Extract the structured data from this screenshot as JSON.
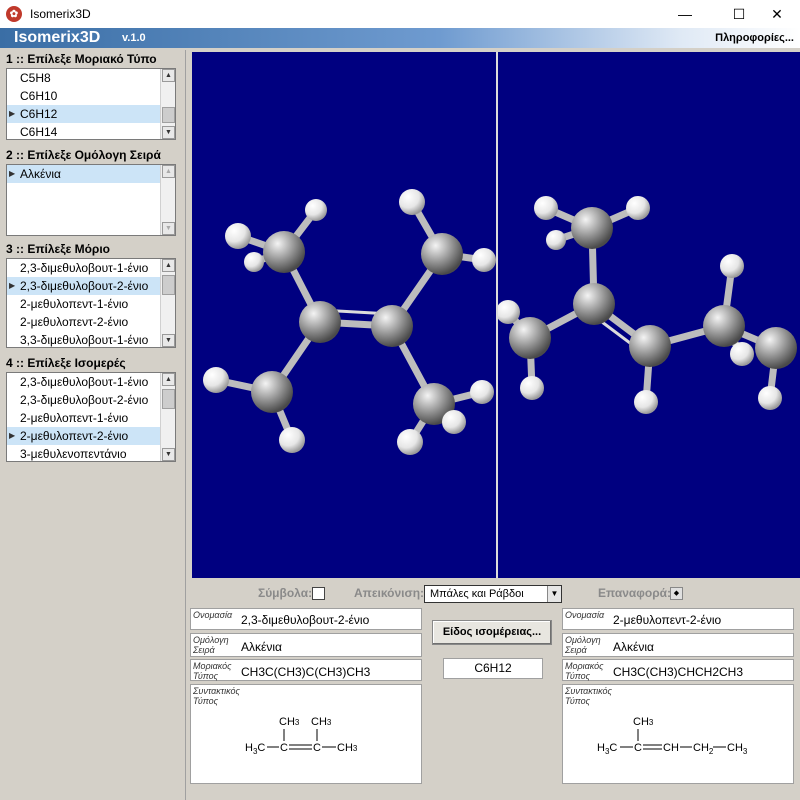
{
  "window": {
    "title": "Isomerix3D",
    "minimize": "—",
    "maximize": "☐",
    "close": "✕"
  },
  "banner": {
    "app_name": "Isomerix3D",
    "version": "v.1.0",
    "info_link": "Πληροφορίες..."
  },
  "step1": {
    "title": "1 :: Επίλεξε Μοριακό Τύπο",
    "items": [
      {
        "label": "C5H8",
        "selected": false
      },
      {
        "label": "C6H10",
        "selected": false
      },
      {
        "label": "C6H12",
        "selected": true
      },
      {
        "label": "C6H14",
        "selected": false
      }
    ]
  },
  "step2": {
    "title": "2 :: Επίλεξε Ομόλογη Σειρά",
    "items": [
      {
        "label": "Αλκένια",
        "selected": true
      }
    ]
  },
  "step3": {
    "title": "3 :: Επίλεξε Μόριο",
    "items": [
      {
        "label": "2,3-διμεθυλοβουτ-1-ένιο",
        "selected": false
      },
      {
        "label": "2,3-διμεθυλοβουτ-2-ένιο",
        "selected": true
      },
      {
        "label": "2-μεθυλοπεντ-1-ένιο",
        "selected": false
      },
      {
        "label": "2-μεθυλοπεντ-2-ένιο",
        "selected": false
      },
      {
        "label": "3,3-διμεθυλοβουτ-1-ένιο",
        "selected": false
      }
    ]
  },
  "step4": {
    "title": "4 :: Επίλεξε Ισομερές",
    "items": [
      {
        "label": "2,3-διμεθυλοβουτ-1-ένιο",
        "selected": false
      },
      {
        "label": "2,3-διμεθυλοβουτ-2-ένιο",
        "selected": false
      },
      {
        "label": "2-μεθυλοπεντ-1-ένιο",
        "selected": false
      },
      {
        "label": "2-μεθυλοπεντ-2-ένιο",
        "selected": true
      },
      {
        "label": "3-μεθυλενοπεντάνιο",
        "selected": false
      }
    ]
  },
  "controls": {
    "symbols_label": "Σύμβολα:",
    "display_label": "Απεικόνιση:",
    "display_value": "Μπάλες και Ράβδοι",
    "reset_label": "Επαναφορά:"
  },
  "left_molecule": {
    "name_label": "Ονομασία",
    "name": "2,3-διμεθυλοβουτ-2-ένιο",
    "series_label_1": "Ομόλογη",
    "series_label_2": "Σειρά",
    "series": "Αλκένια",
    "formula_label_1": "Μοριακός",
    "formula_label_2": "Τύπος",
    "formula": "CH3C(CH3)C(CH3)CH3",
    "structural_label_1": "Συντακτικός",
    "structural_label_2": "Τύπος"
  },
  "right_molecule": {
    "name_label": "Ονομασία",
    "name": "2-μεθυλοπεντ-2-ένιο",
    "series_label_1": "Ομόλογη",
    "series_label_2": "Σειρά",
    "series": "Αλκένια",
    "formula_label_1": "Μοριακός",
    "formula_label_2": "Τύπος",
    "formula": "CH3C(CH3)CHCH2CH3",
    "structural_label_1": "Συντακτικός",
    "structural_label_2": "Τύπος"
  },
  "middle": {
    "isomer_button": "Είδος ισομέρειας...",
    "formula": "C6H12"
  },
  "structural_text": {
    "left_top1": "CH",
    "left_top1_sub": "3",
    "left_top2": "CH",
    "left_top2_sub": "3",
    "left_h3c": "H",
    "left_h3c_sub": "3",
    "left_h3c_c": "C",
    "left_c1": "C",
    "left_c2": "C",
    "left_ch3": "CH",
    "left_ch3_sub": "3",
    "right_top": "CH",
    "right_top_sub": "3",
    "right_h3c": "H",
    "right_h3c_sub": "3",
    "right_h3c_c": "C",
    "right_c": "C",
    "right_ch": "CH",
    "right_ch2": "CH",
    "right_ch2_sub": "2",
    "right_ch3": "CH",
    "right_ch3_sub": "3"
  },
  "colors": {
    "viewer_bg": "#000080",
    "carbon": "#8a8a8a",
    "hydrogen": "#f2f2f2",
    "selection": "#cce4f7",
    "banner": "#3a6ea5"
  }
}
